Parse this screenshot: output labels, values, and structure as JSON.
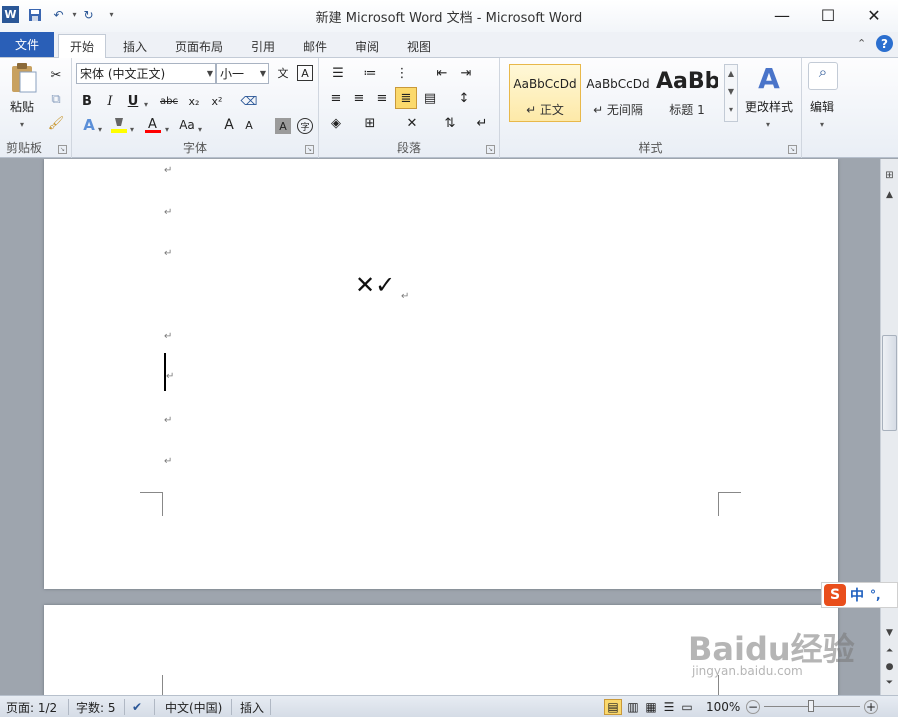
{
  "app": {
    "title": "新建 Microsoft Word 文档 - Microsoft Word"
  },
  "quick_access": {
    "icons": [
      "word-logo-icon",
      "save-icon",
      "undo-icon",
      "redo-icon",
      "customize-icon"
    ]
  },
  "window_controls": {
    "minimize": "—",
    "maximize": "☐",
    "close": "✕"
  },
  "tabs": [
    {
      "label": "文件"
    },
    {
      "label": "开始"
    },
    {
      "label": "插入"
    },
    {
      "label": "页面布局"
    },
    {
      "label": "引用"
    },
    {
      "label": "邮件"
    },
    {
      "label": "审阅"
    },
    {
      "label": "视图"
    }
  ],
  "ribbon": {
    "clipboard": {
      "paste_label": "粘贴",
      "group_label": "剪贴板"
    },
    "font": {
      "font_name": "宋体 (中文正文)",
      "font_size": "小一",
      "group_label": "字体",
      "bold": "B",
      "italic": "I",
      "underline": "U",
      "strike": "abc",
      "subscript": "x₂",
      "superscript": "x²",
      "grow": "A",
      "shrink": "A",
      "change_case": "Aa",
      "char_shade": "A",
      "enclose": "字",
      "phonetic": "文",
      "border": "A"
    },
    "paragraph": {
      "group_label": "段落"
    },
    "styles": {
      "group_label": "样式",
      "items": [
        {
          "sample": "AaBbCcDd",
          "name": "↵ 正文"
        },
        {
          "sample": "AaBbCcDd",
          "name": "↵ 无间隔"
        },
        {
          "sample": "AaBb",
          "name": "标题 1"
        }
      ],
      "change_styles": "更改样式"
    },
    "editing": {
      "label": "编辑"
    }
  },
  "document": {
    "symbols": "✕✓",
    "paragraph_mark": "↵"
  },
  "status": {
    "page": "页面: 1/2",
    "words": "字数: 5",
    "language": "中文(中国)",
    "mode": "插入",
    "zoom": "100%",
    "zoom_minus": "−",
    "zoom_plus": "+"
  },
  "ime": {
    "label": "中",
    "punct": "°,"
  },
  "watermark": {
    "text": "Baidu经验",
    "sub": "jingyan.baidu.com"
  },
  "colors": {
    "accent": "#2a5fb7",
    "highlight": "#ffff00",
    "font_color": "#ff0000"
  }
}
